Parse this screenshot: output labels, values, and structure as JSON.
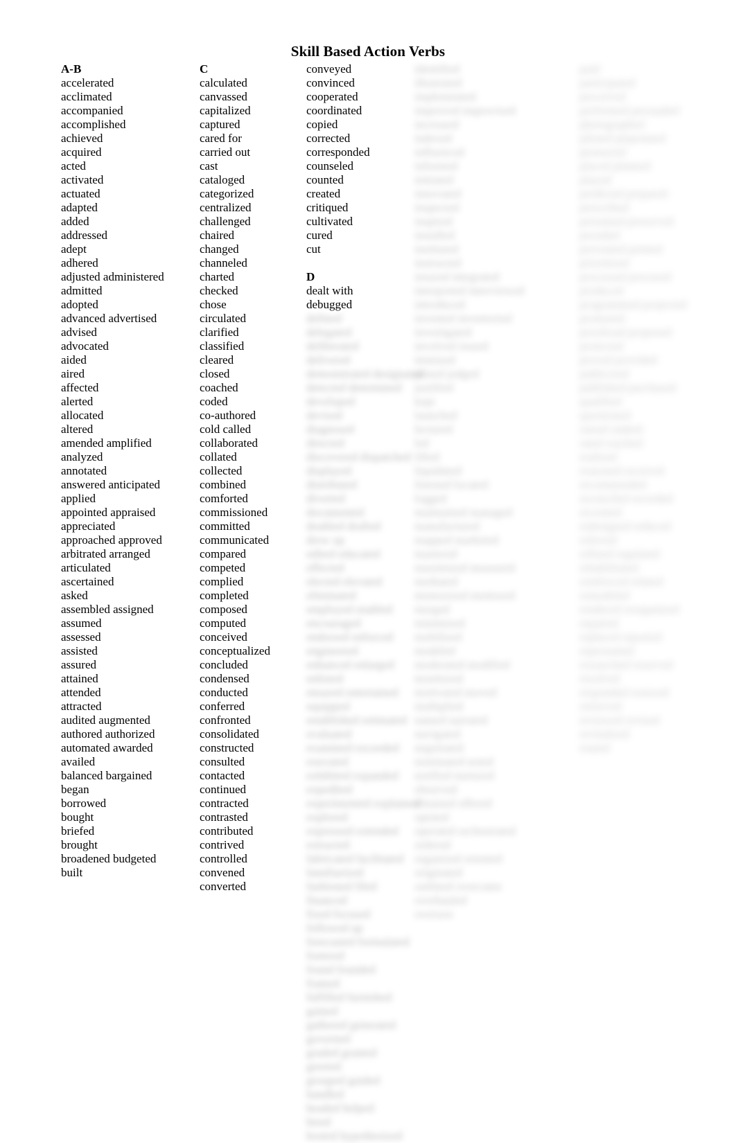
{
  "document": {
    "title": "Skill Based Action Verbs"
  },
  "columns": [
    {
      "id": "column-1",
      "heading": "A-B",
      "entries": [
        "accelerated",
        "acclimated",
        "accompanied",
        "accomplished",
        "achieved",
        "acquired",
        "acted",
        "activated",
        "actuated",
        "adapted",
        "added",
        "addressed",
        "adept",
        "adhered",
        "adjusted administered",
        "admitted",
        "adopted",
        "advanced advertised",
        "advised",
        "advocated",
        "aided",
        "aired",
        "affected",
        "alerted",
        "allocated",
        "altered",
        "amended amplified",
        "analyzed",
        "annotated",
        "answered anticipated",
        "applied",
        "appointed appraised",
        "appreciated",
        "approached approved",
        "arbitrated arranged",
        "articulated",
        "ascertained",
        "asked",
        "assembled assigned",
        "assumed",
        "assessed",
        "assisted",
        "assured",
        "attained",
        "attended",
        "attracted",
        "audited augmented",
        "authored authorized",
        "automated awarded",
        "availed",
        "balanced bargained",
        "began",
        "borrowed",
        "bought",
        "briefed",
        "brought",
        "broadened budgeted",
        "built"
      ]
    },
    {
      "id": "column-2",
      "heading": "C",
      "entries": [
        "calculated",
        "canvassed",
        "capitalized",
        "captured",
        "cared for",
        "carried out",
        "cast",
        "cataloged",
        "categorized",
        "centralized",
        "challenged",
        "chaired",
        "changed",
        "channeled",
        "charted",
        "checked",
        "chose",
        "circulated",
        "clarified",
        "classified",
        "cleared",
        "closed",
        "coached",
        "coded",
        "co-authored",
        "cold called",
        "collaborated",
        "collated",
        "collected",
        "combined",
        "comforted",
        "commissioned",
        "committed",
        "communicated",
        "compared",
        "competed",
        "complied",
        "completed",
        "composed",
        "computed",
        "conceived",
        "conceptualized",
        "concluded",
        "condensed",
        "conducted",
        "conferred",
        "confronted",
        "consolidated",
        "constructed",
        "consulted",
        "contacted",
        "continued",
        "contracted",
        "contrasted",
        "contributed",
        "contrived",
        "controlled",
        "convened",
        "converted"
      ]
    },
    {
      "id": "column-3",
      "heading": "",
      "entries": [
        "conveyed",
        "convinced",
        "cooperated",
        "coordinated",
        "copied",
        "corrected",
        "corresponded",
        "counseled",
        "counted",
        "created",
        "critiqued",
        "cultivated",
        "cured",
        "cut"
      ],
      "section_2": {
        "heading": "D",
        "entries": [
          "dealt with",
          "debugged"
        ]
      },
      "obscured_note": "remainder of column is blurred and illegible"
    },
    {
      "id": "column-4",
      "heading": "",
      "entries": [],
      "obscured_note": "entire column is blurred and illegible"
    },
    {
      "id": "column-5",
      "heading": "",
      "entries": [],
      "obscured_note": "entire column is blurred and illegible"
    }
  ],
  "obscured": {
    "col3_lines": [
      "defined",
      "delegated",
      "deliberated",
      "delivered",
      "demonstrated designated",
      "detected determined",
      "developed",
      "devised",
      "diagnosed",
      "directed",
      "discovered dispatched",
      "displayed",
      "distributed",
      "diverted",
      "documented",
      "doubled drafted",
      "drew up",
      "edited educated",
      "effected",
      "elected elevated",
      "eliminated",
      "employed enabled",
      "encouraged",
      "endorsed enforced",
      "engineered",
      "enhanced enlarged",
      "enlisted",
      "ensured entertained",
      "equipped",
      "established estimated",
      "evaluated",
      "examined exceeded",
      "executed",
      "exhibited expanded",
      "expedited",
      "experimented explained",
      "explored",
      "expressed extended",
      "extracted",
      "fabricated facilitated",
      "familiarized",
      "fashioned filed",
      "financed",
      "fixed focused",
      "followed up",
      "forecasted formulated",
      "fostered",
      "found founded",
      "framed",
      "fulfilled furnished",
      "gained",
      "gathered generated",
      "governed",
      "graded granted",
      "greeted",
      "grouped guided",
      "handled",
      "headed helped",
      "hired",
      "hosted hypothesized"
    ],
    "col4_lines": [
      "identified",
      "illustrated",
      "implemented",
      "improved improvised",
      "increased",
      "indexed",
      "influenced",
      "informed",
      "initiated",
      "innovated",
      "inspected",
      "inspired",
      "installed",
      "instituted",
      "instructed",
      "insured integrated",
      "interpreted interviewed",
      "introduced",
      "invented inventoried",
      "investigated",
      "involved issued",
      "itemized",
      "joined judged",
      "justified",
      "kept",
      "launched",
      "lectured",
      "led",
      "lifted",
      "liquidated",
      "listened located",
      "logged",
      "maintained managed",
      "manufactured",
      "mapped marketed",
      "mastered",
      "maximized measured",
      "mediated",
      "memorized mentored",
      "merged",
      "minimized",
      "mobilized",
      "modeled",
      "moderated modified",
      "monitored",
      "motivated moved",
      "multiplied",
      "named narrated",
      "navigated",
      "negotiated",
      "nominated noted",
      "notified nurtured",
      "observed",
      "obtained offered",
      "opened",
      "operated orchestrated",
      "ordered",
      "organized oriented",
      "originated",
      "outlined overcame",
      "overhauled",
      "oversaw"
    ],
    "col5_lines": [
      "paid",
      "participated",
      "perceived",
      "performed persuaded",
      "photographed",
      "piloted pinpointed",
      "pioneered",
      "placed planned",
      "played",
      "predicted prepared",
      "prescribed",
      "presented preserved",
      "presided",
      "prevented printed",
      "prioritized",
      "processed procured",
      "produced",
      "programmed projected",
      "promoted",
      "proofread proposed",
      "protected",
      "proved provided",
      "publicized",
      "published purchased",
      "qualified",
      "questioned",
      "raised ranked",
      "rated reached",
      "realized",
      "reasoned received",
      "recommended",
      "reconciled recorded",
      "recruited",
      "redesigned reduced",
      "referred",
      "refined regulated",
      "rehabilitated",
      "reinforced related",
      "remodeled",
      "rendered reorganized",
      "repaired",
      "replaced reported",
      "represented",
      "researched reserved",
      "resolved",
      "responded restored",
      "retrieved",
      "reviewed revised",
      "revitalized",
      "routed"
    ]
  }
}
